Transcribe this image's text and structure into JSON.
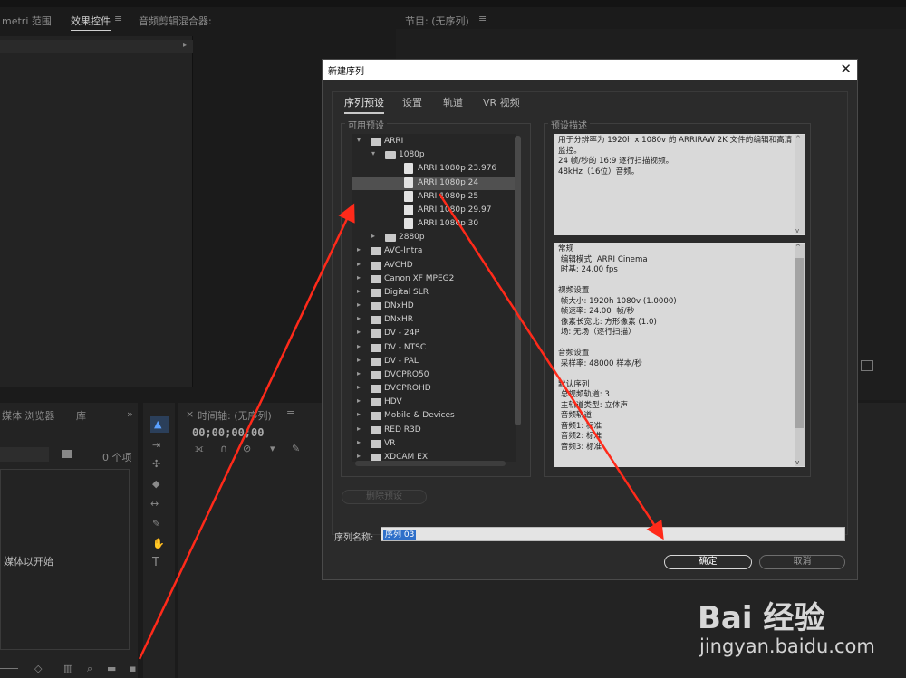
{
  "background": {
    "top_tabs": [
      "metri 范围",
      "效果控件",
      "音频剪辑混合器:",
      "节目: (无序列)"
    ],
    "project_panel_tab": "媒体 浏览器",
    "project_count": "0 个项",
    "project_hint": "媒体以开始",
    "timeline_tab": "时间轴: (无序列)",
    "timecode": "00;00;00;00"
  },
  "dialog": {
    "title": "新建序列",
    "close_icon": "close-icon",
    "tabs": [
      {
        "label": "序列预设",
        "active": true
      },
      {
        "label": "设置",
        "active": false
      },
      {
        "label": "轨道",
        "active": false
      },
      {
        "label": "VR 视频",
        "active": false
      }
    ],
    "available_presets_label": "可用预设",
    "preset_description_label": "预设描述",
    "tree": [
      {
        "label": "ARRI",
        "level": 0,
        "type": "folder",
        "expanded": true
      },
      {
        "label": "1080p",
        "level": 1,
        "type": "folder",
        "expanded": true
      },
      {
        "label": "ARRI 1080p 23.976",
        "level": 2,
        "type": "preset"
      },
      {
        "label": "ARRI 1080p 24",
        "level": 2,
        "type": "preset",
        "selected": true
      },
      {
        "label": "ARRI 1080p 25",
        "level": 2,
        "type": "preset"
      },
      {
        "label": "ARRI 1080p 29.97",
        "level": 2,
        "type": "preset"
      },
      {
        "label": "ARRI 1080p 30",
        "level": 2,
        "type": "preset"
      },
      {
        "label": "2880p",
        "level": 1,
        "type": "folder",
        "expanded": false
      },
      {
        "label": "AVC-Intra",
        "level": 0,
        "type": "folder",
        "expanded": false
      },
      {
        "label": "AVCHD",
        "level": 0,
        "type": "folder",
        "expanded": false
      },
      {
        "label": "Canon XF MPEG2",
        "level": 0,
        "type": "folder",
        "expanded": false
      },
      {
        "label": "Digital SLR",
        "level": 0,
        "type": "folder",
        "expanded": false
      },
      {
        "label": "DNxHD",
        "level": 0,
        "type": "folder",
        "expanded": false
      },
      {
        "label": "DNxHR",
        "level": 0,
        "type": "folder",
        "expanded": false
      },
      {
        "label": "DV - 24P",
        "level": 0,
        "type": "folder",
        "expanded": false
      },
      {
        "label": "DV - NTSC",
        "level": 0,
        "type": "folder",
        "expanded": false
      },
      {
        "label": "DV - PAL",
        "level": 0,
        "type": "folder",
        "expanded": false
      },
      {
        "label": "DVCPRO50",
        "level": 0,
        "type": "folder",
        "expanded": false
      },
      {
        "label": "DVCPROHD",
        "level": 0,
        "type": "folder",
        "expanded": false
      },
      {
        "label": "HDV",
        "level": 0,
        "type": "folder",
        "expanded": false
      },
      {
        "label": "Mobile & Devices",
        "level": 0,
        "type": "folder",
        "expanded": false
      },
      {
        "label": "RED R3D",
        "level": 0,
        "type": "folder",
        "expanded": false
      },
      {
        "label": "VR",
        "level": 0,
        "type": "folder",
        "expanded": false
      },
      {
        "label": "XDCAM EX",
        "level": 0,
        "type": "folder",
        "expanded": false
      }
    ],
    "description": [
      "用于分辨率为 1920h x 1080v 的 ARRIRAW 2K 文件的编辑和高清",
      "监控。",
      "24 帧/秒的 16:9 逐行扫描视频。",
      "48kHz（16位）音频。"
    ],
    "details": [
      "常规",
      " 编辑模式: ARRI Cinema",
      " 时基: 24.00 fps",
      "",
      "视频设置",
      " 帧大小: 1920h 1080v (1.0000)",
      " 帧速率: 24.00  帧/秒",
      " 像素长宽比: 方形像素 (1.0)",
      " 场: 无场（逐行扫描）",
      "",
      "音频设置",
      " 采样率: 48000 样本/秒",
      "",
      "默认序列",
      " 总视频轨道: 3",
      " 主轨道类型: 立体声",
      " 音频轨道:",
      " 音频1: 标准",
      " 音频2: 标准",
      " 音频3: 标准"
    ],
    "delete_preset_label": "删除预设",
    "sequence_name_label": "序列名称:",
    "sequence_name_value": "序列 03",
    "ok_label": "确定",
    "cancel_label": "取消"
  },
  "watermark": {
    "logo": "Bai 经验",
    "url": "jingyan.baidu.com"
  }
}
